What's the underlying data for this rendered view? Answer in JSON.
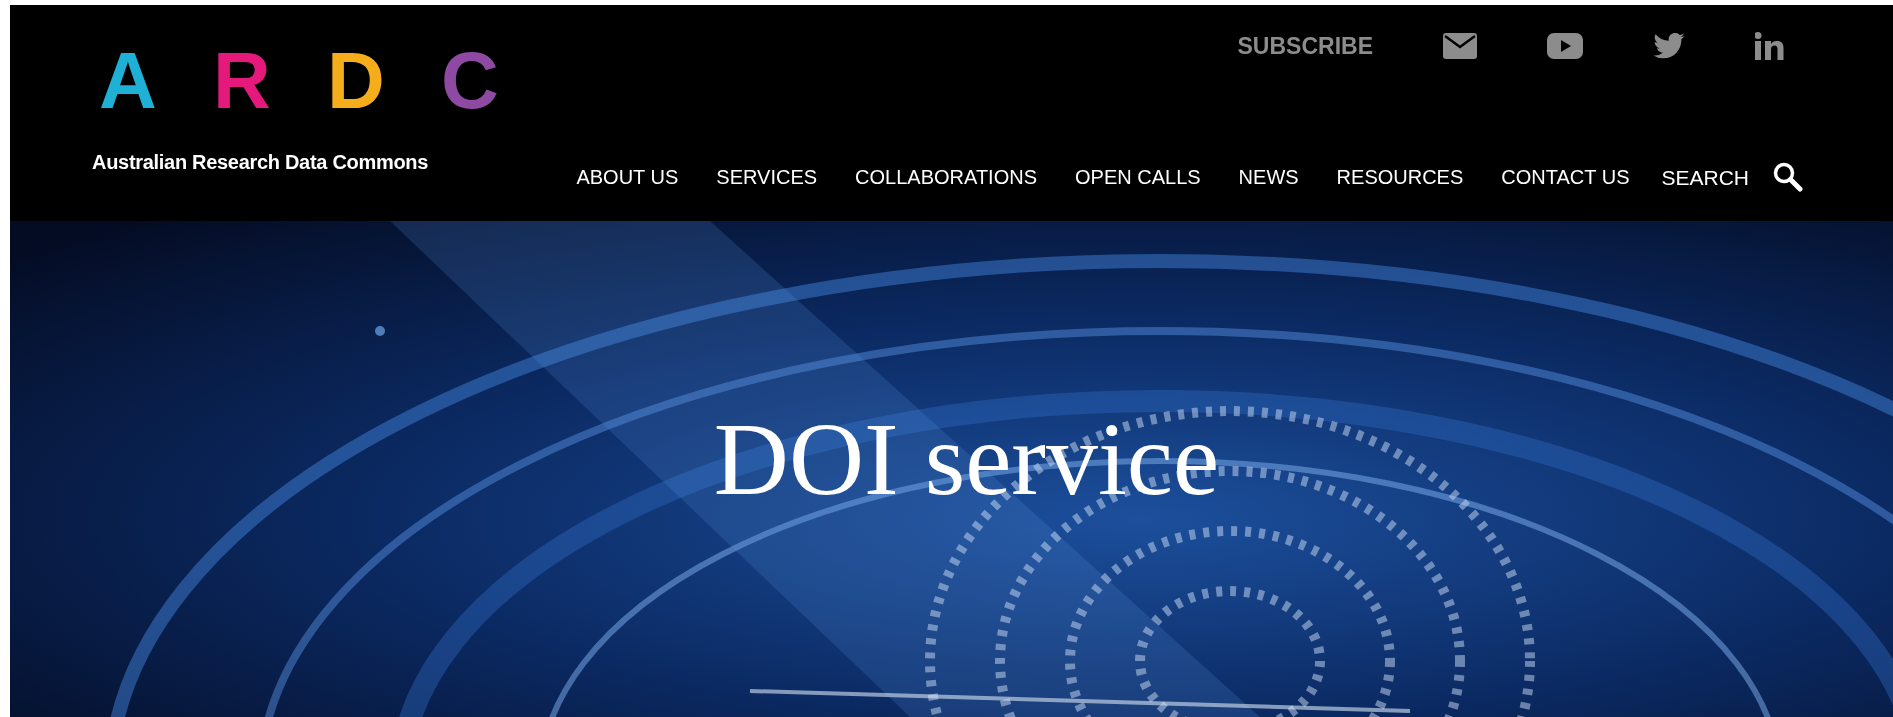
{
  "logo": {
    "letters": [
      {
        "text": "A",
        "color": "#1fb0d6"
      },
      {
        "text": "R",
        "color": "#e5197b"
      },
      {
        "text": "D",
        "color": "#f5ad1b"
      },
      {
        "text": "C",
        "color": "#8e4aa3"
      }
    ],
    "tagline": "Australian Research Data Commons"
  },
  "top_bar": {
    "subscribe": "SUBSCRIBE",
    "social": [
      {
        "kind": "email"
      },
      {
        "kind": "youtube"
      },
      {
        "kind": "twitter"
      },
      {
        "kind": "linkedin"
      }
    ]
  },
  "nav": {
    "items": [
      "ABOUT US",
      "SERVICES",
      "COLLABORATIONS",
      "OPEN CALLS",
      "NEWS",
      "RESOURCES",
      "CONTACT US"
    ],
    "search": "SEARCH"
  },
  "hero": {
    "title": "DOI service"
  }
}
